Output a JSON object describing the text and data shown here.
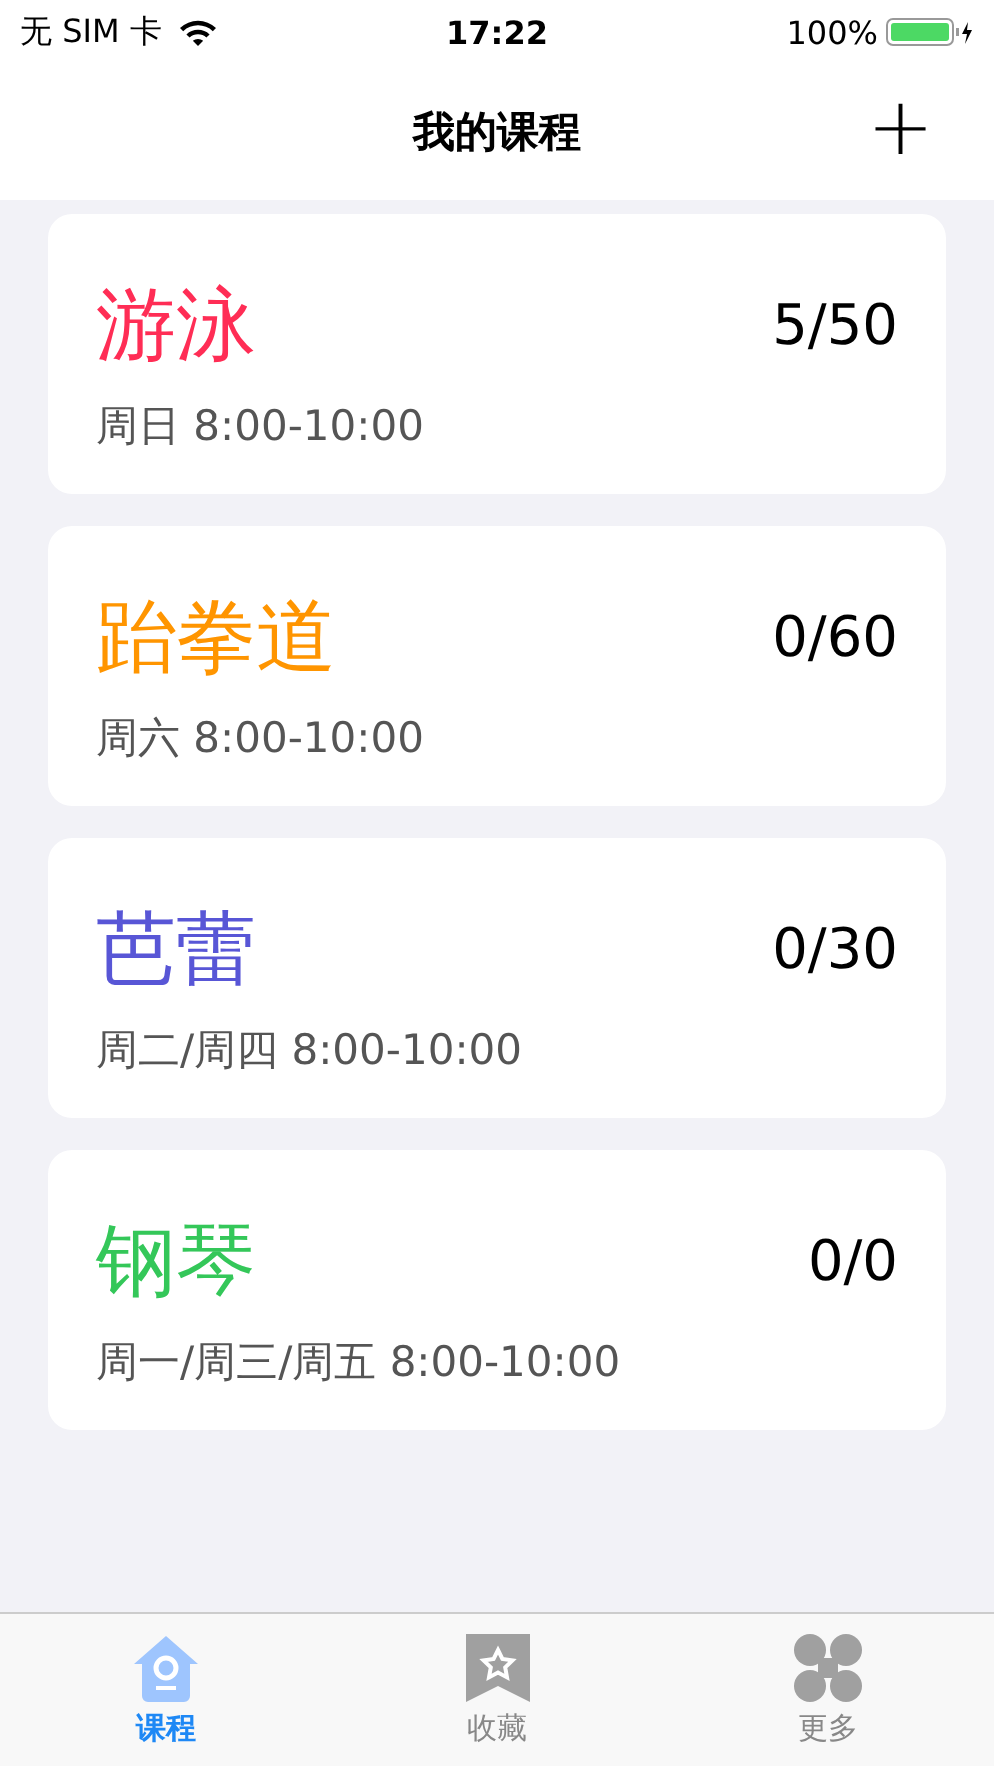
{
  "status_bar": {
    "carrier": "无 SIM 卡",
    "time": "17:22",
    "battery": "100%"
  },
  "nav": {
    "title": "我的课程",
    "action": "+"
  },
  "courses": [
    {
      "name": "游泳",
      "color": "#ff2d55",
      "count": "5/50",
      "schedule": "周日 8:00-10:00"
    },
    {
      "name": "跆拳道",
      "color": "#ff9500",
      "count": "0/60",
      "schedule": "周六 8:00-10:00"
    },
    {
      "name": "芭蕾",
      "color": "#5856d6",
      "count": "0/30",
      "schedule": "周二/周四 8:00-10:00"
    },
    {
      "name": "钢琴",
      "color": "#34c759",
      "count": "0/0",
      "schedule": "周一/周三/周五 8:00-10:00"
    }
  ],
  "tabs": [
    {
      "kind": "home",
      "label": "课程",
      "selected": true
    },
    {
      "kind": "bookmark",
      "label": "收藏",
      "selected": false
    },
    {
      "kind": "grid",
      "label": "更多",
      "selected": false
    }
  ]
}
